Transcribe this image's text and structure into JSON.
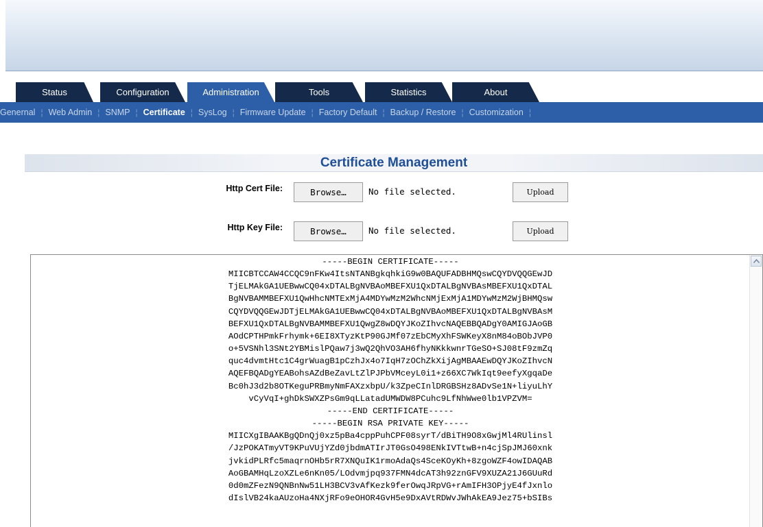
{
  "tabs": [
    {
      "label": "Status",
      "active": false
    },
    {
      "label": "Configuration",
      "active": false
    },
    {
      "label": "Administration",
      "active": true
    },
    {
      "label": "Tools",
      "active": false
    },
    {
      "label": "Statistics",
      "active": false
    },
    {
      "label": "About",
      "active": false
    }
  ],
  "subnav": [
    {
      "label": "Genernal",
      "active": false
    },
    {
      "label": "Web Admin",
      "active": false
    },
    {
      "label": "SNMP",
      "active": false
    },
    {
      "label": "Certificate",
      "active": true
    },
    {
      "label": "SysLog",
      "active": false
    },
    {
      "label": "Firmware Update",
      "active": false
    },
    {
      "label": "Factory Default",
      "active": false
    },
    {
      "label": "Backup / Restore",
      "active": false
    },
    {
      "label": "Customization",
      "active": false
    }
  ],
  "page_title": "Certificate Management",
  "form": {
    "cert": {
      "label": "Http Cert File:",
      "browse_label": "Browse…",
      "status": "No file selected.",
      "upload_label": "Upload"
    },
    "key": {
      "label": "Http Key File:",
      "browse_label": "Browse…",
      "status": "No file selected.",
      "upload_label": "Upload"
    }
  },
  "certificate_lines": [
    "-----BEGIN CERTIFICATE-----",
    "MIICBTCCAW4CCQC9nFKw4ItsNTANBgkqhkiG9w0BAQUFADBHMQswCQYDVQQGEwJD",
    "TjELMAkGA1UEBwwCQ04xDTALBgNVBAoMBEFXU1QxDTALBgNVBAsMBEFXU1QxDTAL",
    "BgNVBAMMBEFXU1QwHhcNMTExMjA4MDYwMzM2WhcNMjExMjA1MDYwMzM2WjBHMQsw",
    "CQYDVQQGEwJDTjELMAkGA1UEBwwCQ04xDTALBgNVBAoMBEFXU1QxDTALBgNVBAsM",
    "BEFXU1QxDTALBgNVBAMMBEFXU1QwgZ8wDQYJKoZIhvcNAQEBBQADgY0AMIGJAoGB",
    "AOdCPTHPmkFrhymk+6EI8XTyzKtP90GJMf07zEbCMyXhFSWKeyX8nM84oBObJVP0",
    "o+5VSNhl3SNt2YBMislPQaw7j3wQ2QhVO3AH6fhyNKkkwnrTGeSO+SJ08tF9zmZq",
    "quc4dvmtHtc1C4grWuagB1pCzhJx4o7IqH7zOChZkXijAgMBAAEwDQYJKoZIhvcN",
    "AQEFBQADgYEABohsAZdBeZavLtZlPJPbVMceyL0i1+z66XC7WkIqt9eefyXgqaDe",
    "Bc0hJ3d2b8OTKeguPRBmyNmFAXzxbpU/k3ZpeCInlDRGBSHz8ADvSe1N+liyuLhY",
    "vCyVqI+ghDkSWXZPsGm9qLLatadUMWDW8PCuhc9LfNhWwe0lb1VPZVM=",
    "-----END CERTIFICATE-----",
    "-----BEGIN RSA PRIVATE KEY-----",
    "MIICXgIBAAKBgQDnQj0xz5pBa4cppPuhCPF08syrT/dBiTH9O8xGwjMl4RUlinsl",
    "/JzPOKATmyVT9KPuVUjYZd0jbdmATIrJT0GsO498ENkIVTtwB+n4cjSpJMJ60xnk",
    "jvkidPLRfc5maqrnOHb5rR7XNQuIK1rmoAdaQs4SceKOyKh+8zgoWZF4owIDAQAB",
    "AoGBAMHqLzoXZLe6nKn05/LOdvmjpq937FMN4dcAT3h92znGFV9XUZA21J6GUuRd",
    "0d0mZFezN9QNBnNw51LH3BCV3vAfKezk9ferOwqJRpVG+rAmIFH3OPjyE4fJxnlo",
    "dIslVB24kaAUzoHa4NXjRFo9eOHOR4GvH5e9DxAVtRDWvJWhAkEA9Jez75+bSIBs"
  ],
  "colors": {
    "tab_bg": "#152a4a",
    "active_bg": "#2c5fa8",
    "title": "#1f4f96"
  }
}
